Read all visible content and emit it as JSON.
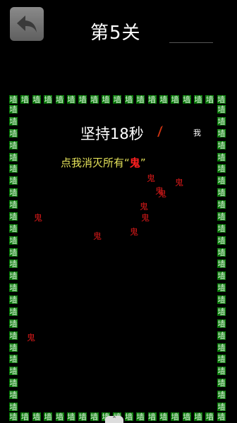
{
  "header": {
    "level_title": "第5关",
    "back_icon": "back-arrow-icon"
  },
  "game": {
    "timer_text": "坚持18秒",
    "player_label": "我",
    "hint": {
      "prefix": "点我消灭所有",
      "open_quote": "“",
      "ghost_word": "鬼",
      "close_quote": "”"
    },
    "wall_char": "墙",
    "ghost_char": "鬼",
    "ghost_count": 10
  },
  "colors": {
    "wall_green": "#0a7a0a",
    "ghost_red": "#d01818",
    "hint_yellow": "#e6e35a",
    "background": "#000000"
  },
  "bottom_handle_icon": "chevron-up-icon"
}
